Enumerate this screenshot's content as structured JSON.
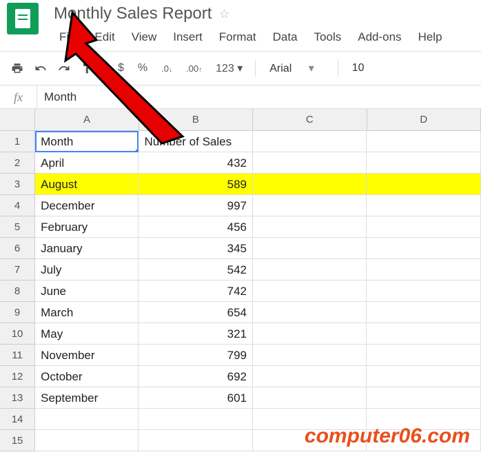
{
  "doc": {
    "title": "Monthly Sales Report"
  },
  "menu": {
    "file": "File",
    "edit": "Edit",
    "view": "View",
    "insert": "Insert",
    "format": "Format",
    "data": "Data",
    "tools": "Tools",
    "addons": "Add-ons",
    "help": "Help"
  },
  "toolbar": {
    "currency": "$",
    "percent": "%",
    "dec_dec": ".0",
    "inc_dec": ".00",
    "more_formats": "123",
    "font_name": "Arial",
    "font_size": "10"
  },
  "formula": {
    "fx": "fx",
    "value": "Month"
  },
  "columns": {
    "a": "A",
    "b": "B",
    "c": "C",
    "d": "D"
  },
  "headers": {
    "month": "Month",
    "sales": "Number of Sales"
  },
  "rows": [
    {
      "n": "1",
      "a": "Month",
      "b": "Number of Sales",
      "hl": false,
      "header": true
    },
    {
      "n": "2",
      "a": "April",
      "b": "432",
      "hl": false
    },
    {
      "n": "3",
      "a": "August",
      "b": "589",
      "hl": true
    },
    {
      "n": "4",
      "a": "December",
      "b": "997",
      "hl": false
    },
    {
      "n": "5",
      "a": "February",
      "b": "456",
      "hl": false
    },
    {
      "n": "6",
      "a": "January",
      "b": "345",
      "hl": false
    },
    {
      "n": "7",
      "a": "July",
      "b": "542",
      "hl": false
    },
    {
      "n": "8",
      "a": "June",
      "b": "742",
      "hl": false
    },
    {
      "n": "9",
      "a": "March",
      "b": "654",
      "hl": false
    },
    {
      "n": "10",
      "a": "May",
      "b": "321",
      "hl": false
    },
    {
      "n": "11",
      "a": "November",
      "b": "799",
      "hl": false
    },
    {
      "n": "12",
      "a": "October",
      "b": "692",
      "hl": false
    },
    {
      "n": "13",
      "a": "September",
      "b": "601",
      "hl": false
    },
    {
      "n": "14",
      "a": "",
      "b": "",
      "hl": false
    },
    {
      "n": "15",
      "a": "",
      "b": "",
      "hl": false
    }
  ],
  "watermark": "computer06.com",
  "chart_data": {
    "type": "table",
    "title": "Monthly Sales Report",
    "columns": [
      "Month",
      "Number of Sales"
    ],
    "rows": [
      [
        "April",
        432
      ],
      [
        "August",
        589
      ],
      [
        "December",
        997
      ],
      [
        "February",
        456
      ],
      [
        "January",
        345
      ],
      [
        "July",
        542
      ],
      [
        "June",
        742
      ],
      [
        "March",
        654
      ],
      [
        "May",
        321
      ],
      [
        "November",
        799
      ],
      [
        "October",
        692
      ],
      [
        "September",
        601
      ]
    ]
  }
}
